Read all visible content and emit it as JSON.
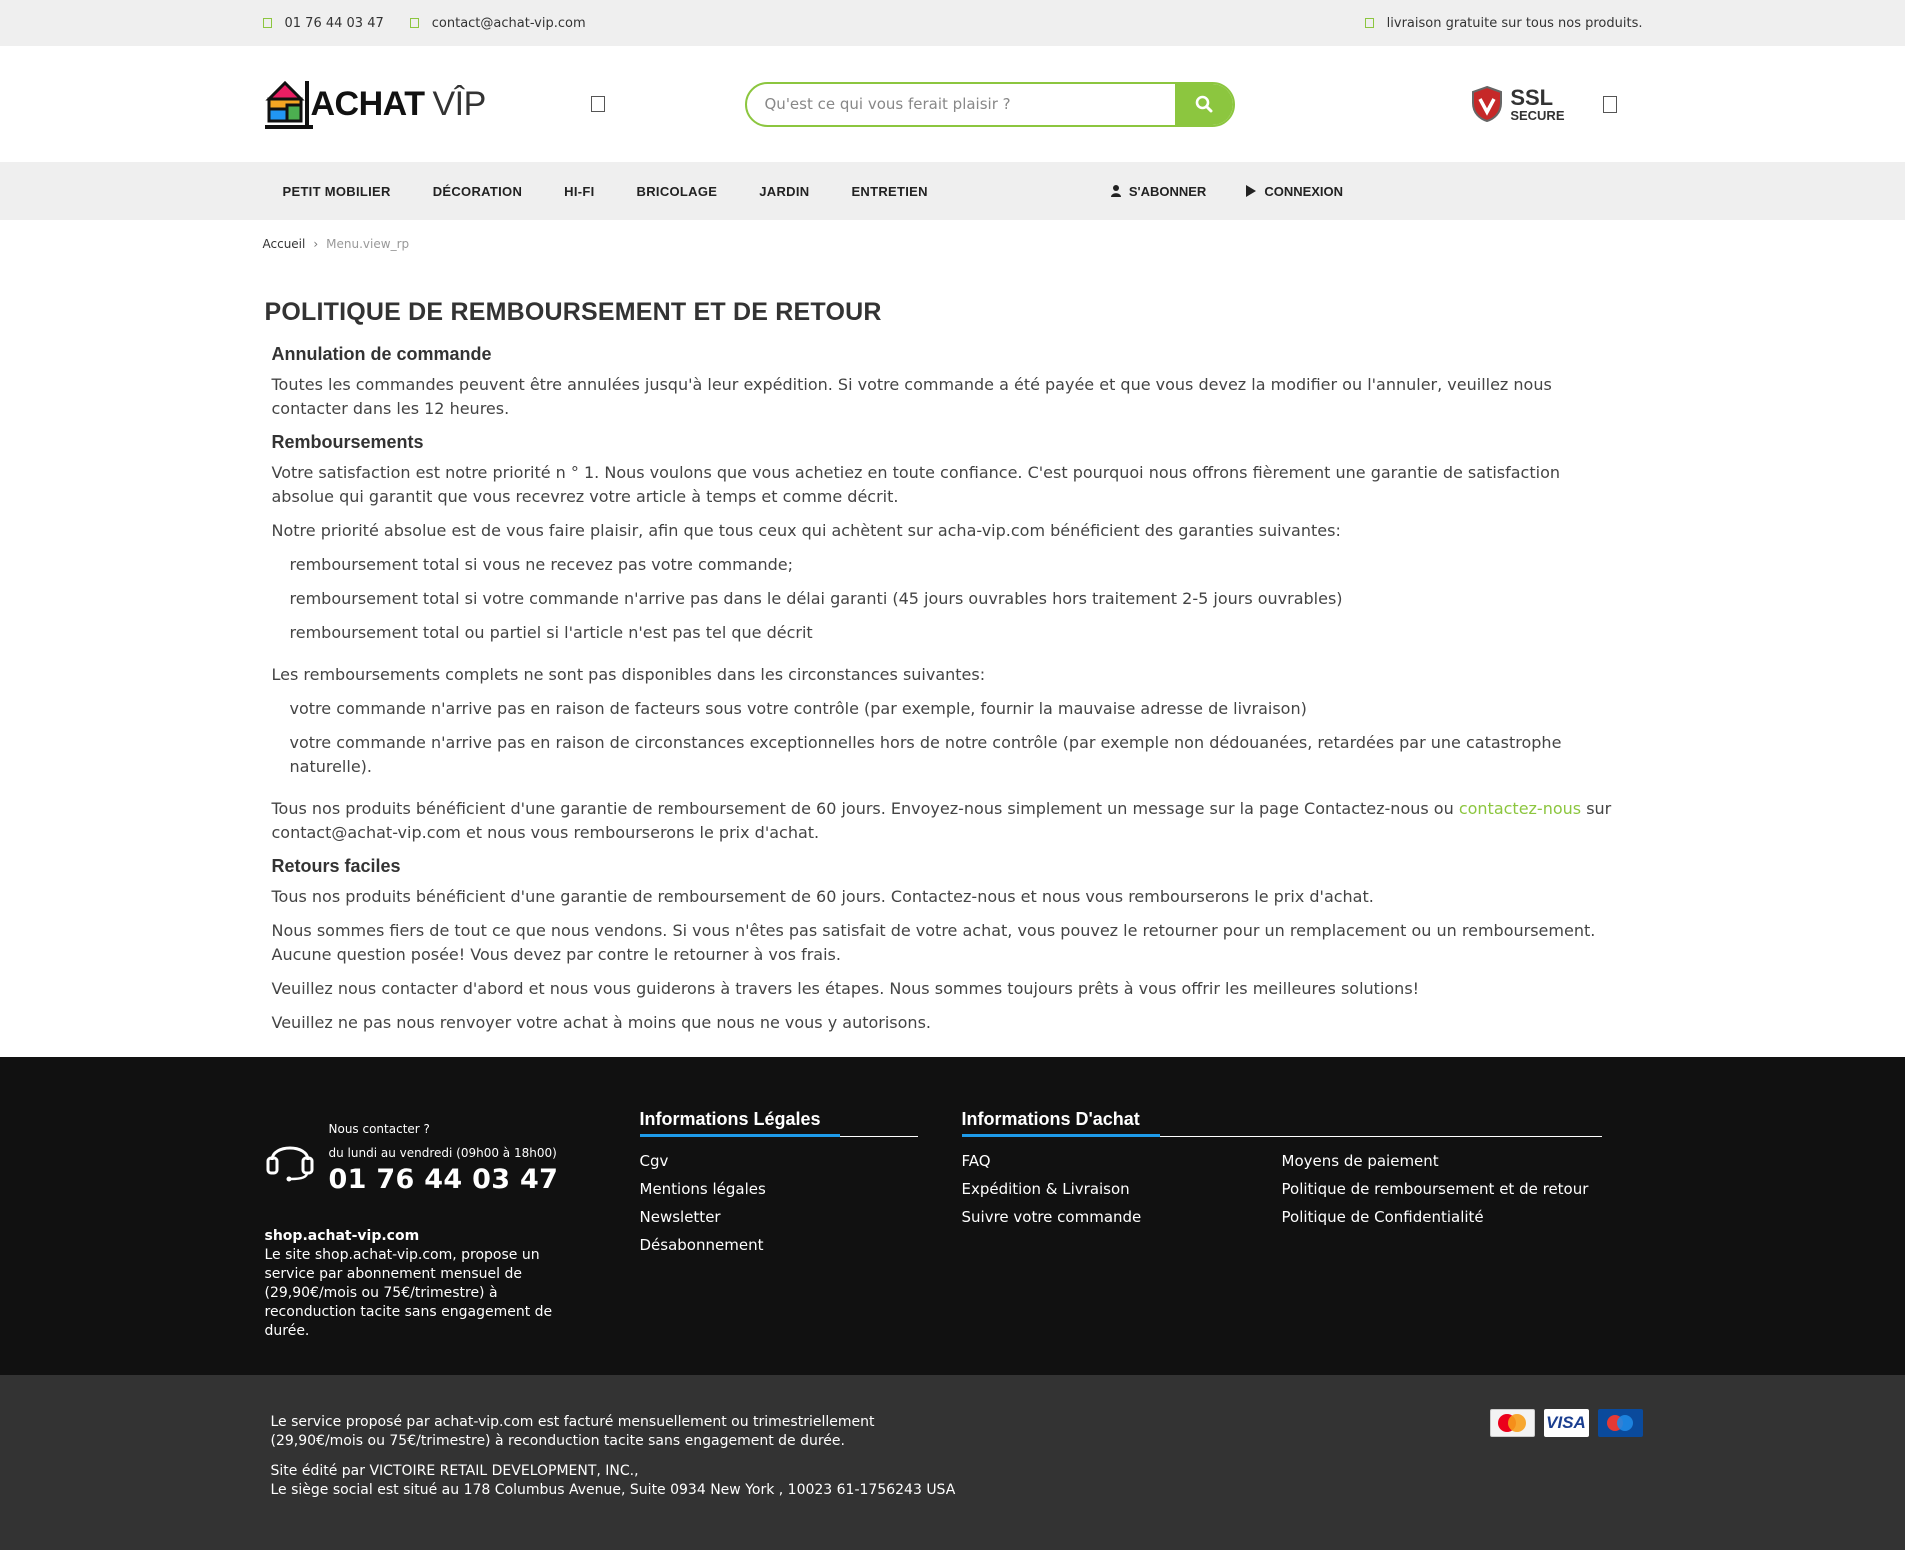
{
  "topbar": {
    "phone": "01 76 44 03 47",
    "email": "contact@achat-vip.com",
    "shipping": "livraison gratuite sur tous nos produits."
  },
  "header": {
    "logo_main": "ACHAT",
    "logo_vip": "VÎP",
    "search_placeholder": "Qu'est ce qui vous ferait plaisir ?",
    "ssl_line1": "SSL",
    "ssl_line2": "SECURE"
  },
  "nav": {
    "items": [
      "PETIT MOBILIER",
      "DÉCORATION",
      "HI-FI",
      "BRICOLAGE",
      "JARDIN",
      "ENTRETIEN"
    ],
    "subscribe": "S'ABONNER",
    "login": "CONNEXION"
  },
  "breadcrumb": {
    "home": "Accueil",
    "current": "Menu.view_rp"
  },
  "page": {
    "title": "POLITIQUE DE REMBOURSEMENT ET DE RETOUR",
    "sec1_title": "Annulation de commande",
    "sec1_p1": "Toutes les commandes peuvent être annulées jusqu'à leur expédition. Si votre commande a été payée et que vous devez la modifier ou l'annuler, veuillez nous contacter dans les 12 heures.",
    "sec2_title": "Remboursements",
    "sec2_p1": "Votre satisfaction est notre priorité n ° 1. Nous voulons que vous achetiez en toute confiance. C'est pourquoi nous offrons fièrement une garantie de satisfaction absolue qui garantit que vous recevrez votre article à temps et comme décrit.",
    "sec2_p2": "Notre priorité absolue est de vous faire plaisir, afin que tous ceux qui achètent sur acha-vip.com bénéficient des garanties suivantes:",
    "sec2_list1": [
      "remboursement total si vous ne recevez pas votre commande;",
      "remboursement total si votre commande n'arrive pas dans le délai garanti (45 jours ouvrables hors traitement 2-5 jours ouvrables)",
      "remboursement total ou partiel si l'article n'est pas tel que décrit"
    ],
    "sec2_p3": "Les remboursements complets ne sont pas disponibles dans les circonstances suivantes:",
    "sec2_list2": [
      "votre commande n'arrive pas en raison de facteurs sous votre contrôle (par exemple, fournir la mauvaise adresse de livraison)",
      "votre commande n'arrive pas en raison de circonstances exceptionnelles hors de notre contrôle (par exemple non dédouanées, retardées par une catastrophe naturelle)."
    ],
    "sec2_p4_a": "Tous nos produits bénéficient d'une garantie de remboursement de 60 jours. Envoyez-nous simplement un message sur la page Contactez-nous ou ",
    "sec2_p4_link": "contactez-nous",
    "sec2_p4_b": " sur contact@achat-vip.com et nous vous rembourserons le prix d'achat.",
    "sec3_title": "Retours faciles",
    "sec3_p1": "Tous nos produits bénéficient d'une garantie de remboursement de 60 jours. Contactez-nous et nous vous rembourserons le prix d'achat.",
    "sec3_p2": "Nous sommes fiers de tout ce que nous vendons. Si vous n'êtes pas satisfait de votre achat, vous pouvez le retourner pour un remplacement ou un remboursement. Aucune question posée! Vous devez par contre le retourner à vos frais.",
    "sec3_p3": "Veuillez nous contacter d'abord et nous vous guiderons à travers les étapes. Nous sommes toujours prêts à vous offrir les meilleures solutions!",
    "sec3_p4": "Veuillez ne pas nous renvoyer votre achat à moins que nous ne vous y autorisons."
  },
  "footer": {
    "contact_label": "Nous contacter ?",
    "contact_hours": "du lundi au vendredi (09h00 à 18h00)",
    "contact_phone": "01 76 44 03 47",
    "shop_title": "shop.achat-vip.com",
    "shop_text": "Le site shop.achat-vip.com, propose un service par abonnement mensuel de (29,90€/mois ou 75€/trimestre) à reconduction tacite sans engagement de durée.",
    "legal_title": "Informations Légales",
    "legal_links": [
      "Cgv",
      "Mentions légales",
      "Newsletter",
      "Désabonnement"
    ],
    "achat_title": "Informations D'achat",
    "achat_links": [
      "FAQ",
      "Moyens de paiement",
      "Expédition & Livraison",
      "Politique de remboursement et de retour",
      "Suivre votre commande",
      "Politique de Confidentialité"
    ]
  },
  "bottom": {
    "line1": "Le service proposé par achat-vip.com est facturé mensuellement ou trimestriellement (29,90€/mois ou 75€/trimestre) à reconduction tacite sans engagement de durée.",
    "line2": "Site édité par VICTOIRE RETAIL DEVELOPMENT, INC.,",
    "line3": "Le siège social est situé au 178 Columbus Avenue, Suite 0934 New York , 10023 61-1756243 USA",
    "card_visa": "VISA"
  },
  "colors": {
    "accent": "#8cc63f",
    "footer_bg": "#111111",
    "bottom_bg": "#333333",
    "underline_blue": "#1e9be9"
  }
}
